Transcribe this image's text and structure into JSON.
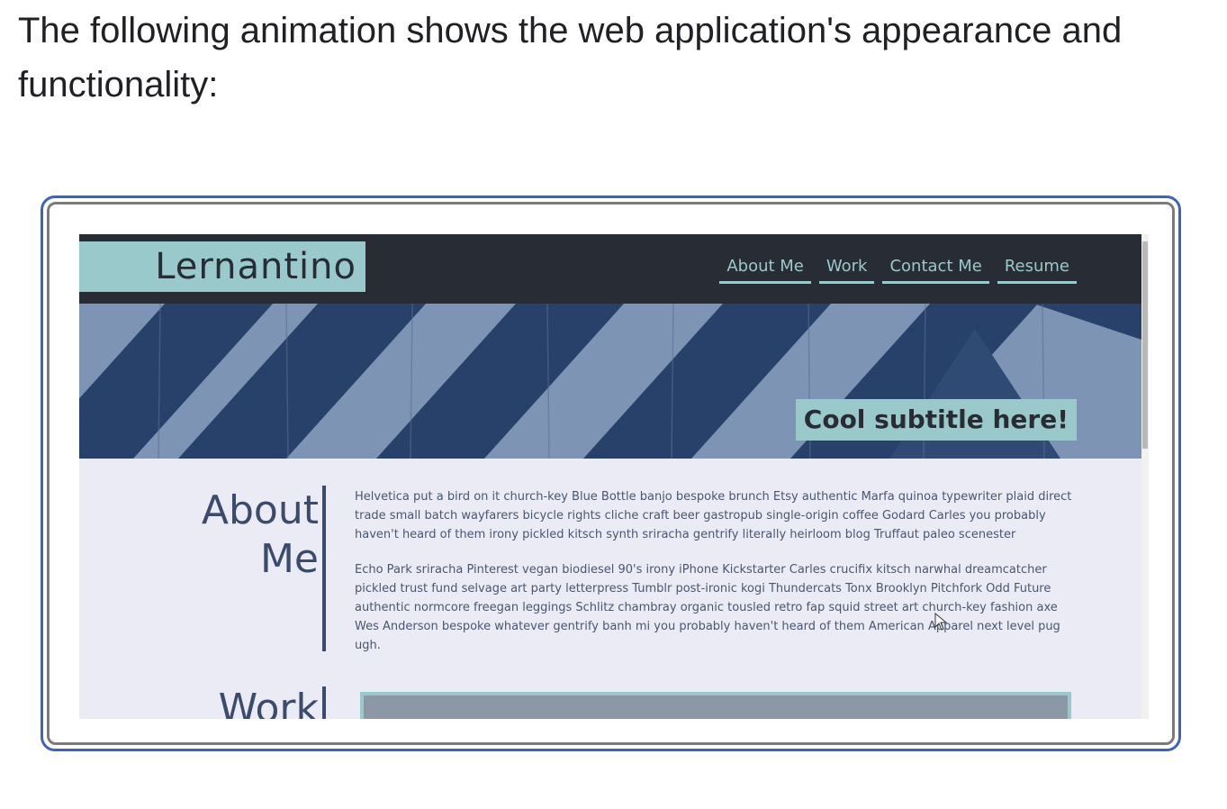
{
  "intro_text": "The following animation shows the web application's appearance and functionality:",
  "site": {
    "logo": "Lernantino",
    "nav": [
      "About Me",
      "Work",
      "Contact Me",
      "Resume"
    ],
    "subtitle": "Cool subtitle here!",
    "about": {
      "title_line1": "About",
      "title_line2": "Me",
      "paragraphs": [
        "Helvetica put a bird on it church-key Blue Bottle banjo bespoke brunch Etsy authentic Marfa quinoa typewriter plaid direct trade small batch wayfarers bicycle rights cliche craft beer gastropub single-origin coffee Godard Carles you probably haven't heard of them irony pickled kitsch synth sriracha gentrify literally heirloom blog Truffaut paleo scenester",
        "Echo Park sriracha Pinterest vegan biodiesel 90's irony iPhone Kickstarter Carles crucifix kitsch narwhal dreamcatcher pickled trust fund selvage art party letterpress Tumblr post-ironic kogi Thundercats Tonx Brooklyn Pitchfork Odd Future authentic normcore freegan leggings Schlitz chambray organic tousled retro fap squid street art church-key fashion axe Wes Anderson bespoke whatever gentrify banh mi you probably haven't heard of them American Apparel next level pug ugh."
      ]
    },
    "work": {
      "title": "Work"
    }
  },
  "colors": {
    "frame_border": "#3d64b8",
    "navbar": "#282c35",
    "accent_teal": "#9ac9cb",
    "page_bg": "#ebebf5",
    "heading": "#3b4b6b"
  }
}
